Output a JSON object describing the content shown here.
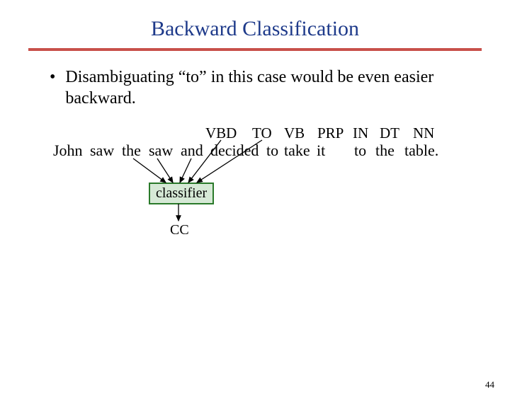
{
  "title": "Backward Classification",
  "bullet": "Disambiguating “to” in this case would be even easier backward.",
  "tags": {
    "vbd": "VBD",
    "to": "TO",
    "vb": "VB",
    "prp": "PRP",
    "in": "IN",
    "dt": "DT",
    "nn": "NN"
  },
  "words": {
    "john": "John",
    "saw1": "saw",
    "the1": "the",
    "saw2": "saw",
    "and": "and",
    "decided": "decided",
    "to1": "to",
    "take": "take",
    "it": "it",
    "to2": "to",
    "the2": "the",
    "table": "table."
  },
  "classifier": "classifier",
  "output": "CC",
  "page": "44"
}
